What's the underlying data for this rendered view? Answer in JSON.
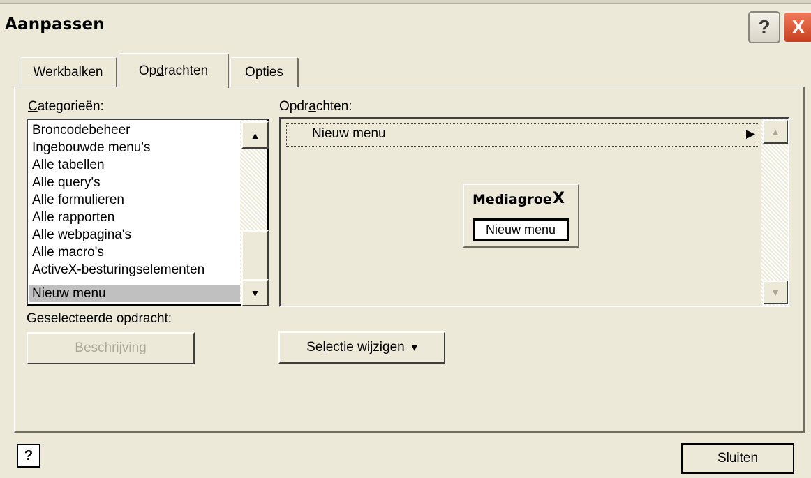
{
  "window": {
    "title": "Aanpassen",
    "help_glyph": "?",
    "close_glyph": "X"
  },
  "tabs": [
    {
      "label": "Werkbalken",
      "accesskey": "W",
      "selected": false
    },
    {
      "label": "Opdrachten",
      "accesskey": "d",
      "selected": true
    },
    {
      "label": "Opties",
      "accesskey": "O",
      "selected": false
    }
  ],
  "categories": {
    "label": "Categorieën:",
    "items": [
      "Broncodebeheer",
      "Ingebouwde menu's",
      "Alle tabellen",
      "Alle query's",
      "Alle formulieren",
      "Alle rapporten",
      "Alle webpagina's",
      "Alle macro's",
      "ActiveX-besturingselementen",
      "Nieuw menu"
    ],
    "selected": "Nieuw menu"
  },
  "commands": {
    "label": "Opdrachten:",
    "items": [
      {
        "label": "Nieuw menu",
        "has_submenu": true
      }
    ]
  },
  "floating_toolbar": {
    "title": "Mediagroe",
    "close_glyph": "X",
    "button_label": "Nieuw menu"
  },
  "selected_command": {
    "label": "Geselecteerde opdracht:",
    "description_button": "Beschrijving",
    "modify_button": "Selectie wijzigen"
  },
  "footer": {
    "close_button": "Sluiten",
    "help_icon": "?"
  },
  "icons": {
    "scroll_up": "▲",
    "scroll_down": "▼",
    "submenu_arrow": "▶",
    "dropdown_arrow": "▾"
  },
  "colors": {
    "face": "#ece9d8",
    "selection": "#c0c0c0",
    "close_button": "#d8502f"
  }
}
